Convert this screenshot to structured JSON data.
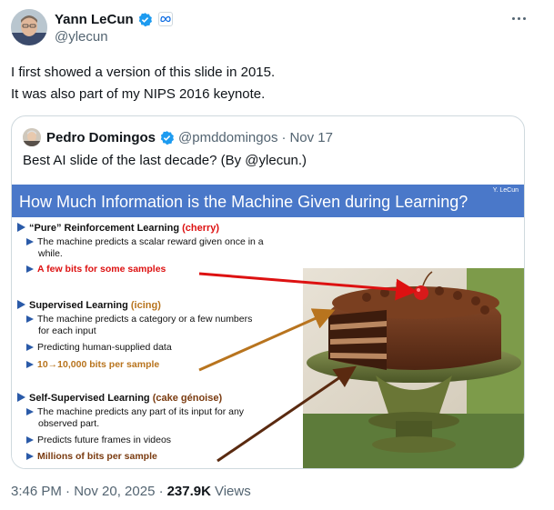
{
  "author": {
    "name": "Yann LeCun",
    "handle": "@ylecun",
    "icons": [
      "verified-badge-icon",
      "meta-affiliation-icon",
      "more-icon"
    ]
  },
  "tweet": {
    "line1": "I first showed a version of this slide in 2015.",
    "line2": "It was also part of my NIPS 2016 keynote."
  },
  "quote": {
    "name": "Pedro Domingos",
    "handle": "@pmddomingos",
    "separator": "·",
    "date": "Nov 17",
    "text": "Best AI slide of the last decade? (By @ylecun.)",
    "slide": {
      "title": "How Much Information is the Machine Given during Learning?",
      "credit": "Y. LeCun",
      "rl_heading": "“Pure” Reinforcement Learning",
      "rl_tag": "(cherry)",
      "rl_desc_1": "The machine predicts a scalar reward given once in a",
      "rl_desc_2": "while.",
      "rl_bits": "A few bits for some samples",
      "sl_heading": "Supervised Learning",
      "sl_tag": "(icing)",
      "sl_desc_1": "The machine predicts a category or a few numbers",
      "sl_desc_2": "for each input",
      "sl_desc_3": "Predicting human-supplied data",
      "sl_bits": "10→10,000 bits per sample",
      "ssl_heading": "Self-Supervised Learning",
      "ssl_tag": "(cake génoise)",
      "ssl_desc_1": "The machine predicts any part of its input for any",
      "ssl_desc_2": "observed part.",
      "ssl_desc_3": "Predicts future frames in videos",
      "ssl_bits": "Millions of bits per sample",
      "colors": {
        "title_bar": "#4a78c9",
        "cherry": "#dd1111",
        "icing": "#b8741e",
        "cake": "#7a3b10"
      }
    }
  },
  "footer": {
    "time": "3:46 PM · Nov 20, 2025 ·",
    "views": "237.9K",
    "views_label": "Views"
  },
  "colors": {
    "text_primary": "#0f1419",
    "text_secondary": "#536471",
    "verified": "#1d9bf0",
    "border": "#cfd9de"
  }
}
